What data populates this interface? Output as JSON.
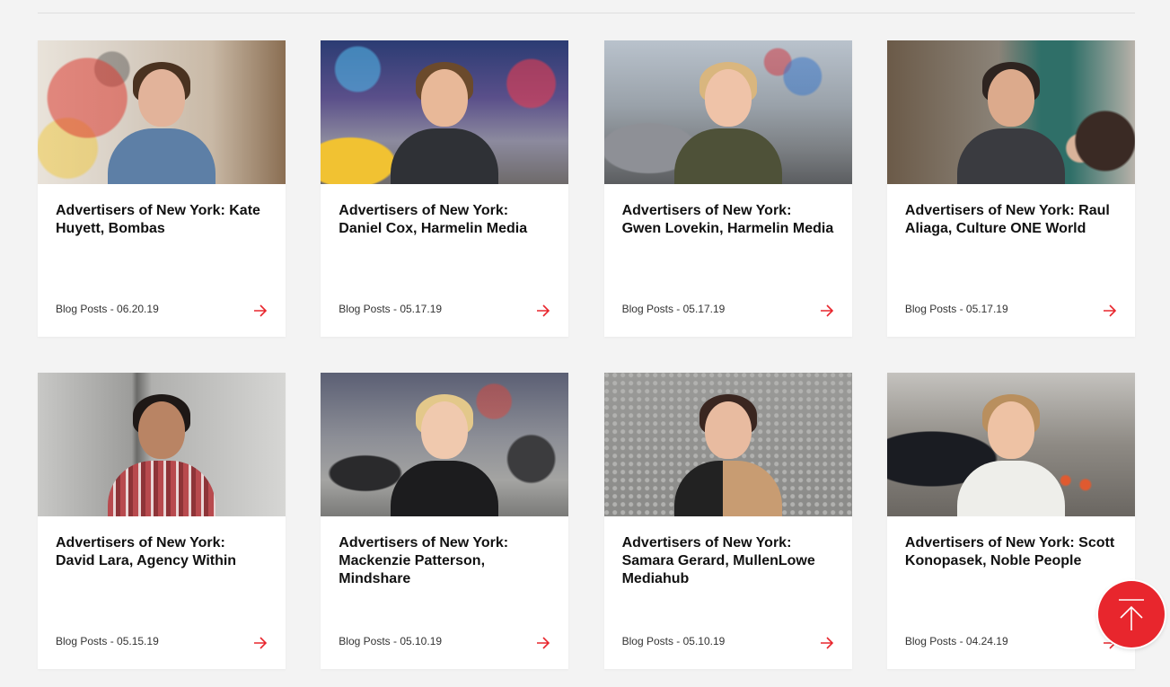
{
  "accent_color": "#e8262d",
  "cards": [
    {
      "title": "Advertisers of New York: Kate Huyett, Bombas",
      "meta": "Blog Posts - 06.20.19"
    },
    {
      "title": "Advertisers of New York: Daniel Cox, Harmelin Media",
      "meta": "Blog Posts - 05.17.19"
    },
    {
      "title": "Advertisers of New York: Gwen Lovekin, Harmelin Media",
      "meta": "Blog Posts - 05.17.19"
    },
    {
      "title": "Advertisers of New York: Raul Aliaga, Culture ONE World",
      "meta": "Blog Posts - 05.17.19"
    },
    {
      "title": "Advertisers of New York: David Lara, Agency Within",
      "meta": "Blog Posts - 05.15.19"
    },
    {
      "title": "Advertisers of New York: Mackenzie Patterson, Mindshare",
      "meta": "Blog Posts - 05.10.19"
    },
    {
      "title": "Advertisers of New York: Samara Gerard, MullenLowe Mediahub",
      "meta": "Blog Posts - 05.10.19"
    },
    {
      "title": "Advertisers of New York: Scott Konopasek, Noble People",
      "meta": "Blog Posts - 04.24.19"
    }
  ],
  "icons": {
    "card_arrow": "arrow-right-icon",
    "scroll_top": "arrow-up-icon"
  }
}
